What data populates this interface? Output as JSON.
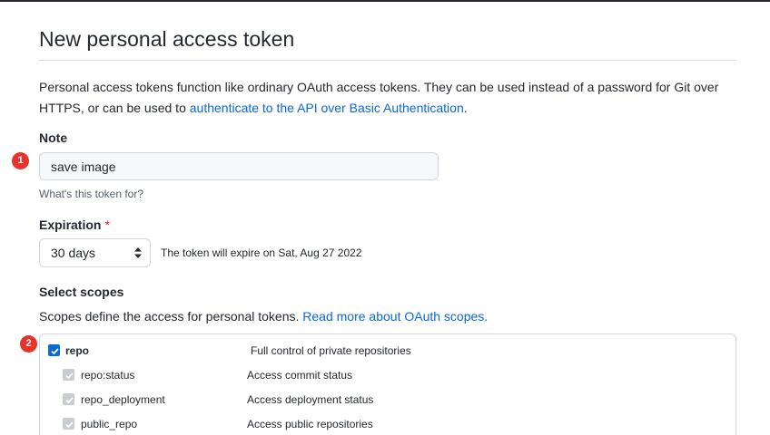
{
  "header": {
    "title": "New personal access token"
  },
  "intro": {
    "text_before": "Personal access tokens function like ordinary OAuth access tokens. They can be used instead of a password for Git over HTTPS, or can be used to ",
    "link": "authenticate to the API over Basic Authentication",
    "text_after": "."
  },
  "note": {
    "label": "Note",
    "value": "save image",
    "hint": "What's this token for?"
  },
  "expiration": {
    "label": "Expiration",
    "required_marker": "*",
    "selected": "30 days",
    "message": "The token will expire on Sat, Aug 27 2022"
  },
  "scopes": {
    "label": "Select scopes",
    "description": "Scopes define the access for personal tokens. ",
    "link": "Read more about OAuth scopes.",
    "items": [
      {
        "name": "repo",
        "description": "Full control of private repositories",
        "checked": true,
        "disabled": false
      },
      {
        "name": "repo:status",
        "description": "Access commit status",
        "checked": true,
        "disabled": true
      },
      {
        "name": "repo_deployment",
        "description": "Access deployment status",
        "checked": true,
        "disabled": true
      },
      {
        "name": "public_repo",
        "description": "Access public repositories",
        "checked": true,
        "disabled": true
      }
    ]
  },
  "annotations": {
    "badge_1": "1",
    "badge_2": "2"
  },
  "colors": {
    "link": "#0969da",
    "required": "#cf222e",
    "badge": "#e5342b"
  }
}
